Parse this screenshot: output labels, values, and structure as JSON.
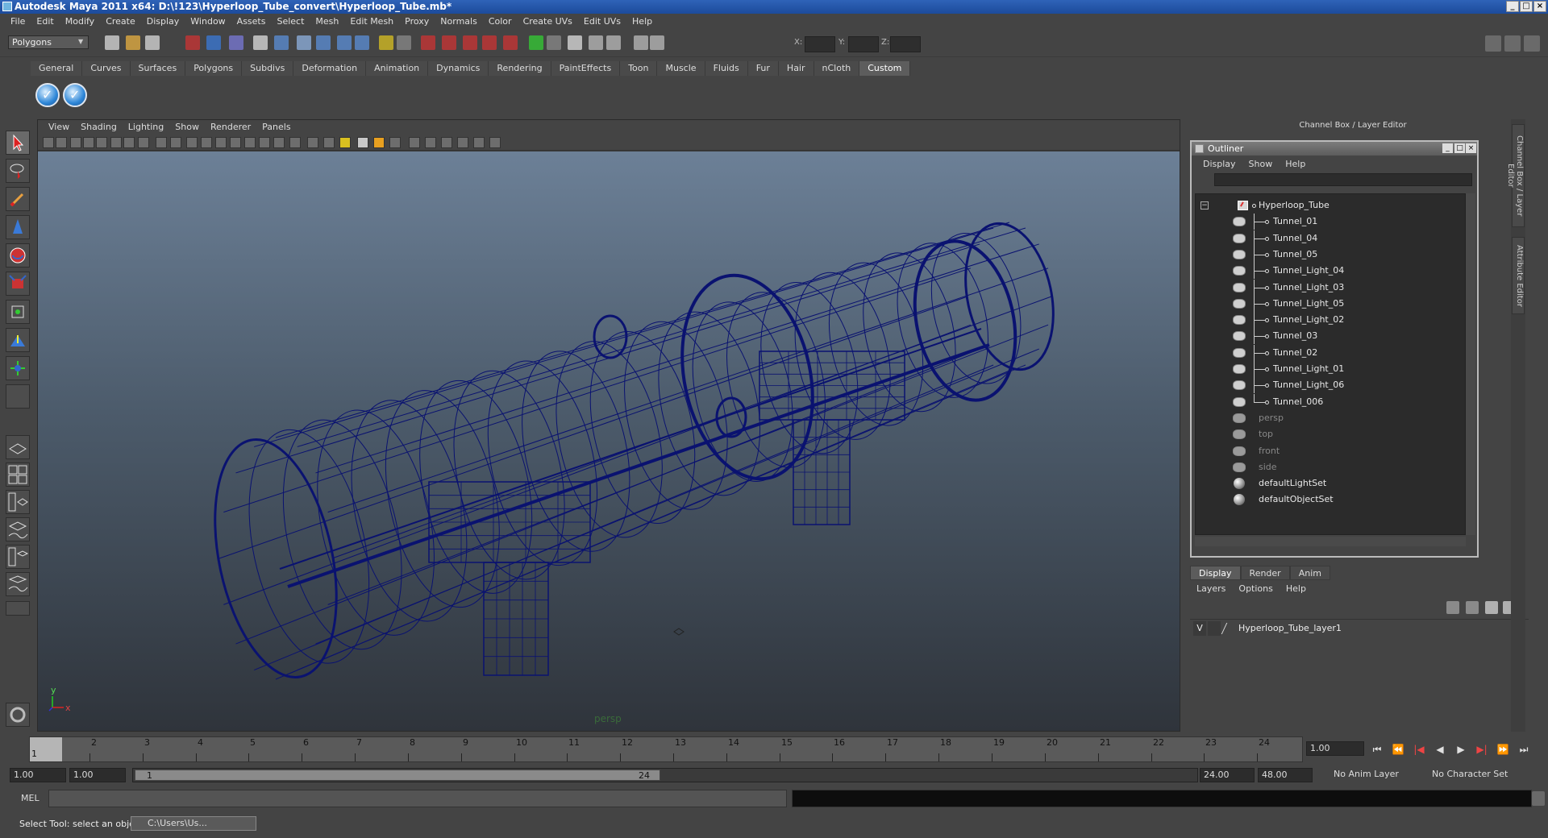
{
  "window": {
    "title": "Autodesk Maya 2011 x64: D:\\!123\\Hyperloop_Tube_convert\\Hyperloop_Tube.mb*",
    "buttons": [
      "_",
      "□",
      "×"
    ]
  },
  "menubar": [
    "File",
    "Edit",
    "Modify",
    "Create",
    "Display",
    "Window",
    "Assets",
    "Select",
    "Mesh",
    "Edit Mesh",
    "Proxy",
    "Normals",
    "Color",
    "Create UVs",
    "Edit UVs",
    "Help"
  ],
  "status": {
    "mode": "Polygons",
    "x_label": "X:",
    "y_label": "Y:",
    "z_label": "Z:"
  },
  "shelf": {
    "tabs": [
      "General",
      "Curves",
      "Surfaces",
      "Polygons",
      "Subdivs",
      "Deformation",
      "Animation",
      "Dynamics",
      "Rendering",
      "PaintEffects",
      "Toon",
      "Muscle",
      "Fluids",
      "Fur",
      "Hair",
      "nCloth",
      "Custom"
    ],
    "active": "Custom"
  },
  "viewport": {
    "menus": [
      "View",
      "Shading",
      "Lighting",
      "Show",
      "Renderer",
      "Panels"
    ],
    "camera": "persp",
    "axis_y": "y",
    "axis_x": "x",
    "wire_color": "#0a1270"
  },
  "rightdock": {
    "title": "Channel Box / Layer Editor",
    "side_tabs": [
      "Channel Box / Layer Editor",
      "Attribute Editor"
    ]
  },
  "outliner": {
    "title": "Outliner",
    "menus": [
      "Display",
      "Show",
      "Help"
    ],
    "root": "Hyperloop_Tube",
    "children": [
      "Tunnel_01",
      "Tunnel_04",
      "Tunnel_05",
      "Tunnel_Light_04",
      "Tunnel_Light_03",
      "Tunnel_Light_05",
      "Tunnel_Light_02",
      "Tunnel_03",
      "Tunnel_02",
      "Tunnel_Light_01",
      "Tunnel_Light_06",
      "Tunnel_006"
    ],
    "cameras": [
      "persp",
      "top",
      "front",
      "side"
    ],
    "sets": [
      "defaultLightSet",
      "defaultObjectSet"
    ]
  },
  "layers": {
    "tabs": [
      "Display",
      "Render",
      "Anim"
    ],
    "active": "Display",
    "menus": [
      "Layers",
      "Options",
      "Help"
    ],
    "visible_flag": "V",
    "layer_name": "Hyperloop_Tube_layer1"
  },
  "timeline": {
    "ticks": [
      "1",
      "2",
      "3",
      "4",
      "5",
      "6",
      "7",
      "8",
      "9",
      "10",
      "11",
      "12",
      "13",
      "14",
      "15",
      "16",
      "17",
      "18",
      "19",
      "20",
      "21",
      "22",
      "23",
      "24"
    ],
    "current_marker": "1",
    "current_frame": "1.00"
  },
  "range": {
    "start": "1.00",
    "playback_start": "1.00",
    "slider_start": "1",
    "slider_end": "24",
    "playback_end": "24.00",
    "end": "48.00",
    "anim_layer": "No Anim Layer",
    "char_set": "No Character Set"
  },
  "command": {
    "label": "MEL"
  },
  "help": {
    "text": "Select Tool: select an object",
    "task": "C:\\Users\\Us..."
  }
}
